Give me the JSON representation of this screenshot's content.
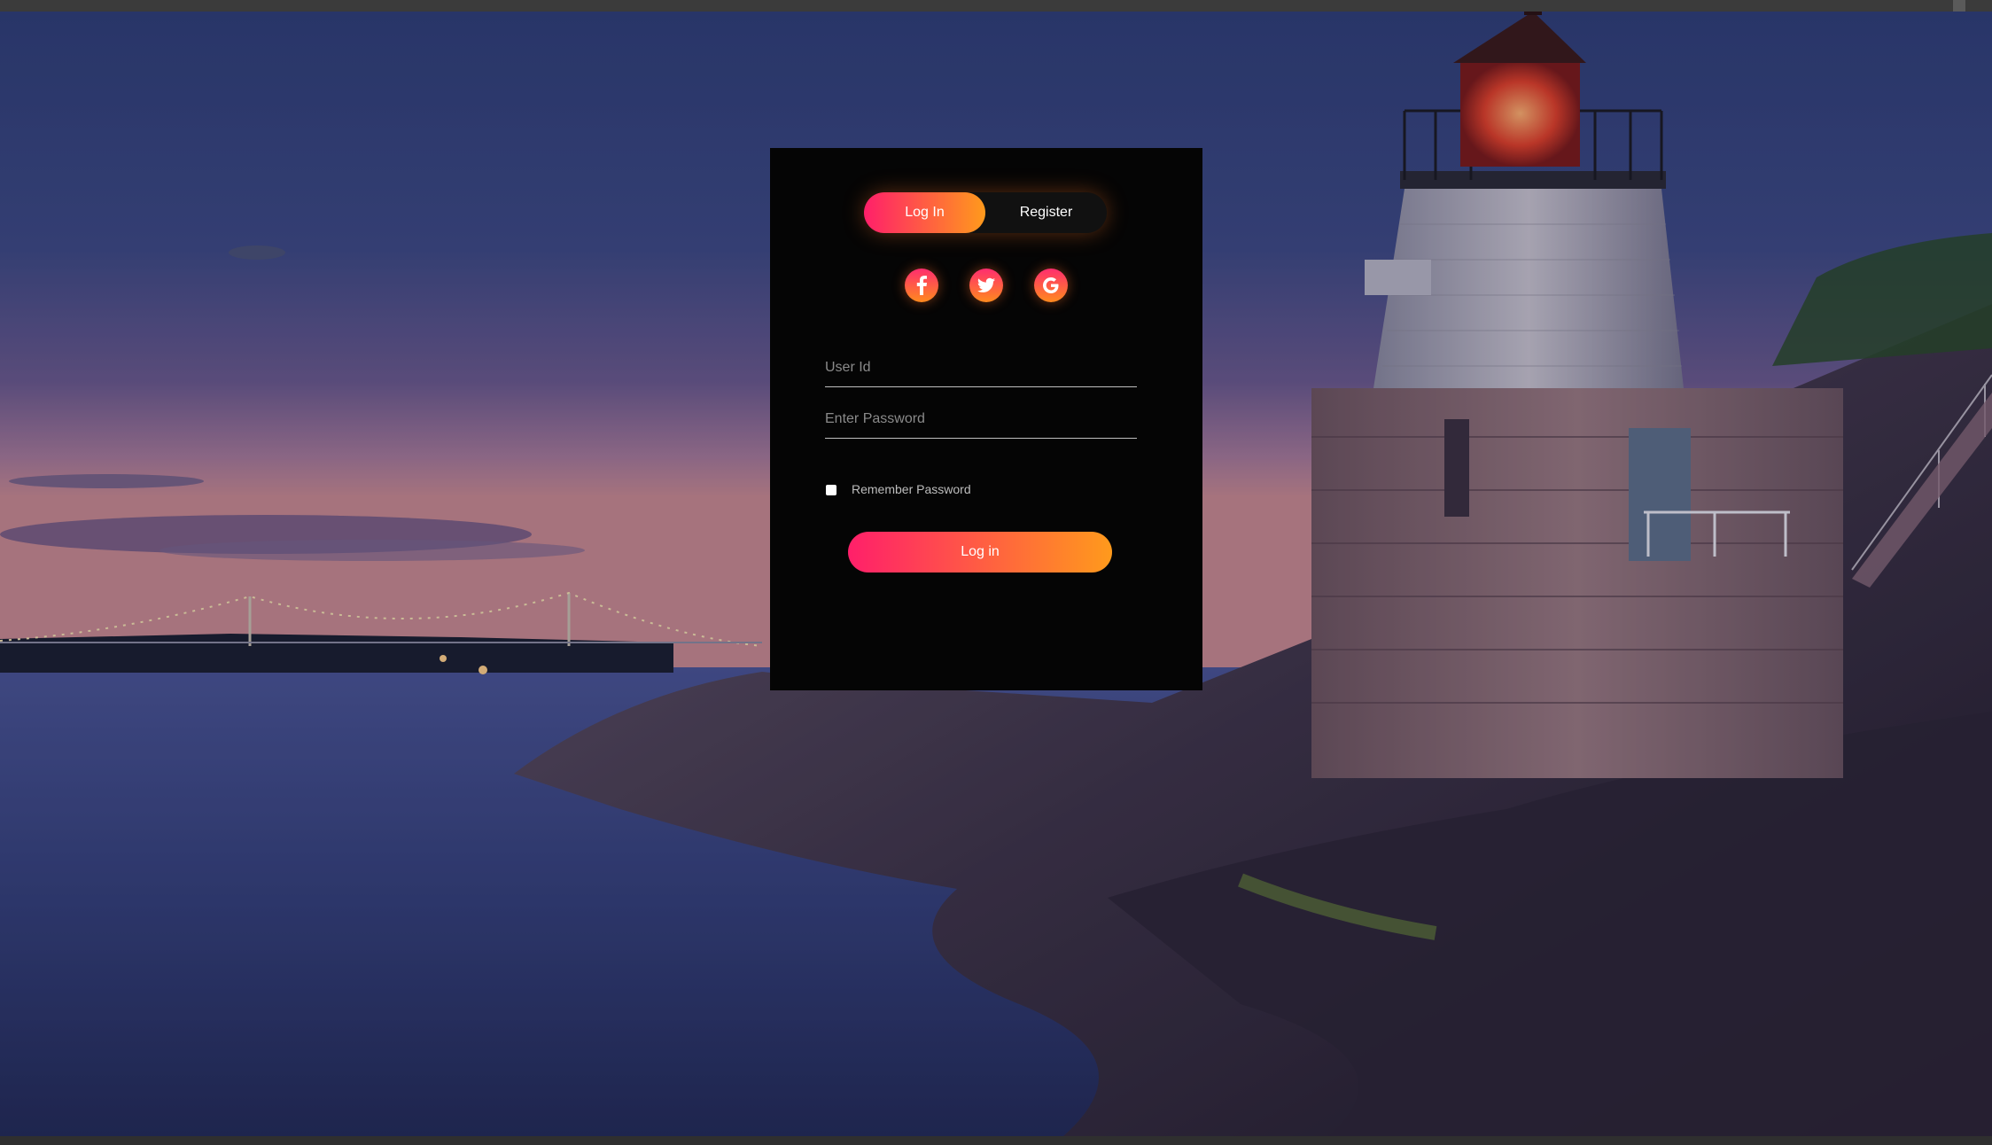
{
  "auth_tabs": {
    "login_label": "Log In",
    "register_label": "Register",
    "active": "login"
  },
  "social_icons": [
    {
      "name": "facebook-icon",
      "glyph": "f"
    },
    {
      "name": "twitter-icon",
      "glyph": "bird"
    },
    {
      "name": "google-icon",
      "glyph": "G"
    }
  ],
  "form": {
    "user_id_placeholder": "User Id",
    "user_id_value": "",
    "password_placeholder": "Enter Password",
    "password_value": "",
    "remember_label": "Remember Password",
    "remember_checked": false,
    "submit_label": "Log in"
  },
  "colors": {
    "accent_start": "#ff1f6a",
    "accent_end": "#ff9a1c",
    "card_background": "#050505"
  }
}
